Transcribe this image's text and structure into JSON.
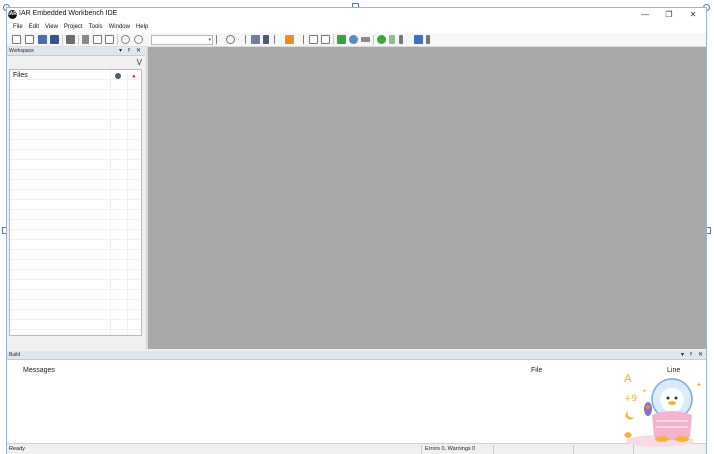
{
  "window": {
    "title": "IAR Embedded Workbench IDE",
    "app_icon_text": "IAR",
    "minimize": "—",
    "restore": "❐",
    "close": "✕"
  },
  "menu": [
    "File",
    "Edit",
    "View",
    "Project",
    "Tools",
    "Window",
    "Help"
  ],
  "workspace": {
    "title": "Workspace",
    "pin": "▾",
    "dock": "ᵖ",
    "close": "✕",
    "filter_label": "V",
    "column_files": "Files"
  },
  "build": {
    "title": "Build",
    "pin": "▾",
    "dock": "ᵖ",
    "close": "✕",
    "col_messages": "Messages",
    "col_file": "File",
    "col_line": "Line"
  },
  "status": {
    "ready": "Ready",
    "errors": "Errors 0, Warnings 0"
  },
  "colors": {
    "editor_bg": "#a9a9a9",
    "toolbar_green": "#3aa63a",
    "toolbar_orange": "#f08a24",
    "toolbar_blue": "#3a6fc4"
  }
}
